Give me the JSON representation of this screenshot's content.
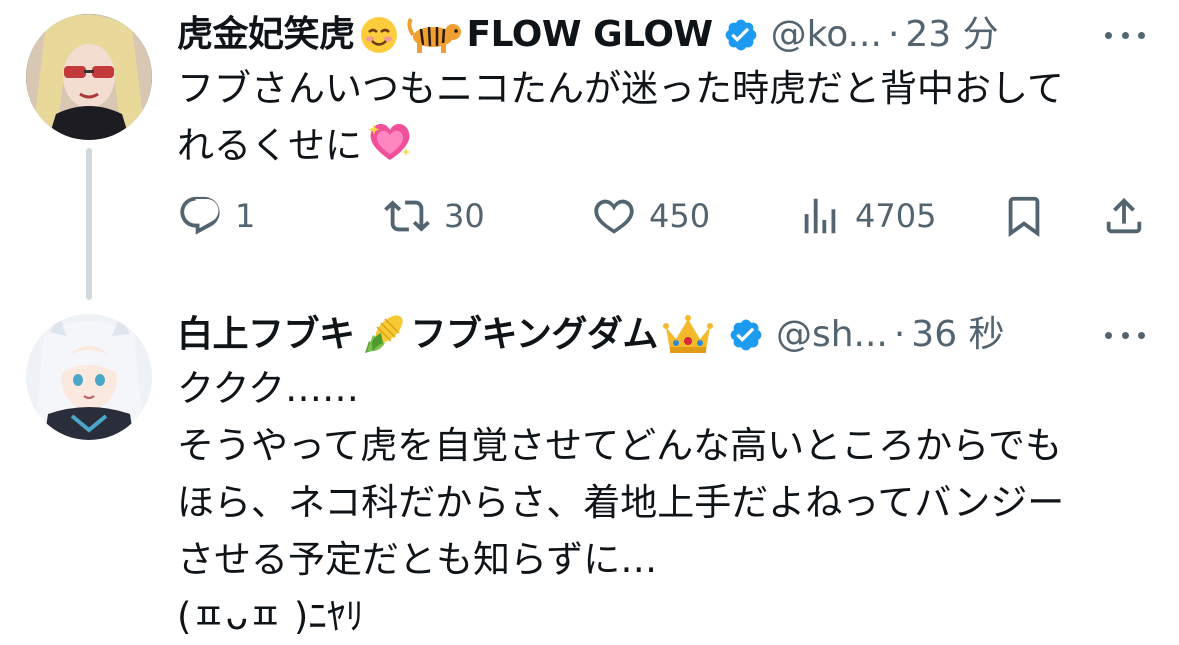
{
  "tweets": [
    {
      "display_name": "虎金妃笑虎",
      "name_emojis": [
        "smiling-face-icon",
        "tiger-icon"
      ],
      "name_suffix": "FLOW GLOW",
      "handle": "@ko...",
      "separator": "·",
      "time": "23 分",
      "body_lines": [
        "フブさんいつもニコたんが迷った時虎だと背中おして",
        "れるくせに"
      ],
      "body_trailing_emoji": "sparkling-heart-icon",
      "actions": {
        "reply_count": "1",
        "repost_count": "30",
        "like_count": "450",
        "views_count": "4705"
      }
    },
    {
      "display_name": "白上フブキ",
      "name_emojis": [
        "corn-icon"
      ],
      "name_suffix": "フブキングダム",
      "name_suffix_emoji": "crown-icon",
      "handle": "@sh...",
      "separator": "·",
      "time": "36 秒",
      "body_lines": [
        "ククク……",
        "そうやって虎を自覚させてどんな高いところからでも",
        "ほら、ネコ科だからさ、着地上手だよねってバンジー",
        "させる予定だとも知らずに…",
        "(ㅍᴗㅍ )ﾆﾔﾘ"
      ]
    }
  ],
  "colors": {
    "text": "#0f1419",
    "secondary": "#536471",
    "verified": "#1d9bf0",
    "thread_line": "#cfd9de"
  }
}
